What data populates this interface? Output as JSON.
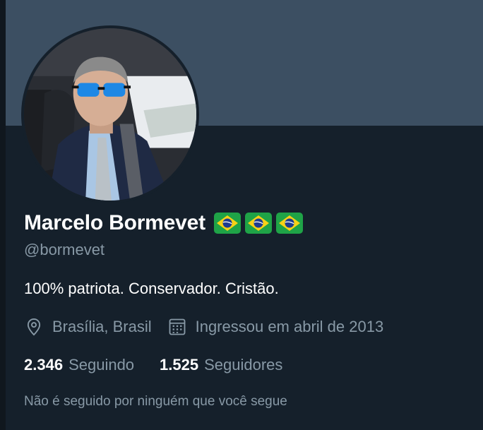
{
  "profile": {
    "name": "Marcelo Bormevet",
    "flag_icons": [
      "brazil-flag-icon",
      "brazil-flag-icon",
      "brazil-flag-icon"
    ],
    "handle": "@bormevet",
    "bio": "100% patriota. Conservador. Cristão.",
    "location": "Brasília, Brasil",
    "joined": "Ingressou em abril de 2013",
    "following_count": "2.346",
    "following_label": "Seguindo",
    "followers_count": "1.525",
    "followers_label": "Seguidores",
    "followed_by_text": "Não é seguido por ninguém que você segue"
  },
  "icons": {
    "location": "location-pin-icon",
    "joined": "calendar-icon"
  },
  "colors": {
    "background": "#15202b",
    "banner": "#3c4f62",
    "text_primary": "#ffffff",
    "text_secondary": "#8899a6"
  }
}
